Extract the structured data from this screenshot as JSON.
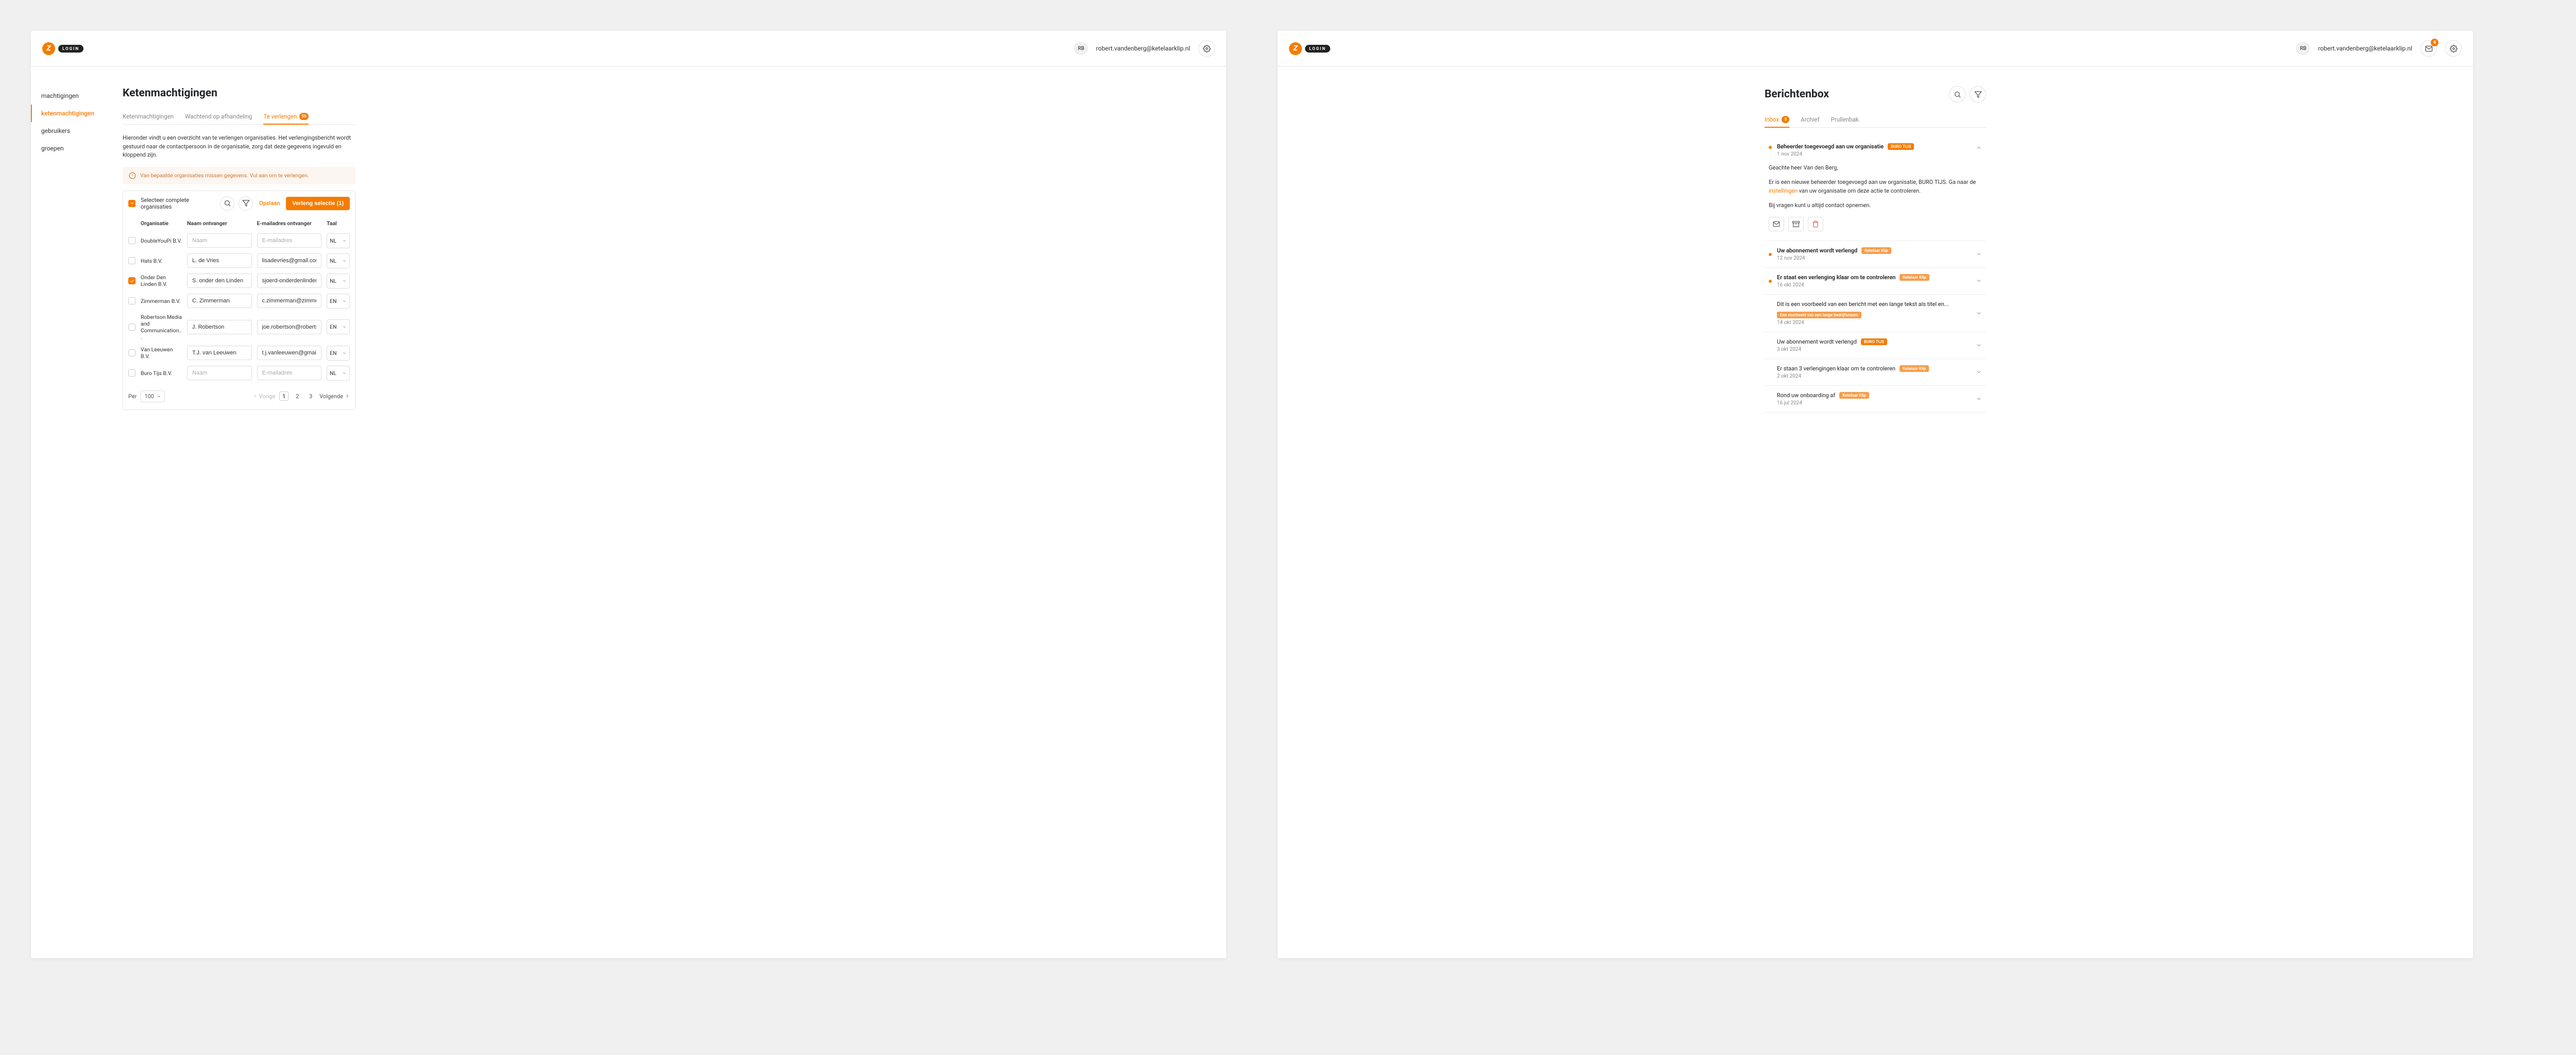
{
  "brand": {
    "letter": "Z",
    "pill": "LOGIN"
  },
  "user": {
    "initials": "RB",
    "email": "robert.vandenberg@ketelaarklip.nl"
  },
  "inbox_badge": "4",
  "colors": {
    "primary": "#f57c00",
    "tag_buro": "#f57c00",
    "tag_ketelaar": "#f79d4a",
    "tag_long": "#f79d4a"
  },
  "left": {
    "title": "Ketenmachtigingen",
    "sidebar": [
      {
        "label": "machtigingen"
      },
      {
        "label": "ketenmachtigingen"
      },
      {
        "label": "gebruikers"
      },
      {
        "label": "groepen"
      }
    ],
    "tabs": [
      {
        "label": "Ketenmachtigingen"
      },
      {
        "label": "Wachtend op afhandeling"
      },
      {
        "label": "Te verlengen",
        "badge": "56"
      }
    ],
    "intro": "Hieronder vindt u een overzicht van te verlengen organisaties. Het verlengingsbericht wordt gestuurd naar de contactpersoon in de organisatie, zorg dat deze gegevens ingevuld en kloppend zijn.",
    "alert": "Van bepaalde organisaties missen gegevens. Vul aan om te verlengen.",
    "toolbar": {
      "select_label": "Selecteer complete organisaties",
      "save": "Opslaan",
      "extend": "Verleng selectie (1)"
    },
    "columns": {
      "org": "Organisatie",
      "name": "Naam ontvanger",
      "email": "E-mailadres ontvanger",
      "lang": "Taal"
    },
    "placeholders": {
      "name": "Naam",
      "email": "E-mailadres"
    },
    "rows": [
      {
        "checked": false,
        "org": "DoubleYouPi B.V.",
        "name": "",
        "email": "",
        "lang": "NL"
      },
      {
        "checked": false,
        "org": "Hats B.V.",
        "name": "L. de Vries",
        "email": "lisadevries@gmail.com",
        "lang": "NL"
      },
      {
        "checked": true,
        "org": "Onder Den Linden B.V.",
        "name": "S. onder den Linden",
        "email": "sjoerd-onderdenlinden@onderdenl",
        "lang": "NL"
      },
      {
        "checked": false,
        "org": "Zimmerman B.V.",
        "name": "C. Zimmerman",
        "email": "c.zimmerman@zimmerman.com",
        "lang": "EN"
      },
      {
        "checked": false,
        "org": "Robertson Media and Communication...",
        "name": "J. Robertson",
        "email": "joe.robertson@robertsoncommun",
        "lang": "EN"
      },
      {
        "checked": false,
        "org": "Van Leeuwen B.V.",
        "name": "T.J. van Leeuwen",
        "email": "t.j.vanleeuwen@gmail.com",
        "lang": "EN"
      },
      {
        "checked": false,
        "org": "Buro Tijs B.V.",
        "name": "",
        "email": "",
        "lang": "NL"
      }
    ],
    "pagination": {
      "per_label": "Per",
      "per_value": "100",
      "prev": "Vorige",
      "next": "Volgende",
      "pages": [
        "1",
        "2",
        "3"
      ]
    }
  },
  "right": {
    "title": "Berichtenbox",
    "tabs": [
      {
        "label": "Inbox",
        "badge": "3"
      },
      {
        "label": "Archief"
      },
      {
        "label": "Prullenbak"
      }
    ],
    "messages": [
      {
        "unread": true,
        "expanded": true,
        "title": "Beheerder toegevoegd aan uw organisatie",
        "tag": "BURO TIJS",
        "tag_color": "tag_buro",
        "date": "1 nov 2024",
        "body_greeting": "Geachte heer Van den Berg,",
        "body_line1a": "Er is een nieuwe beheerder toegevoegd aan uw organisatie, BURO TIJS. Ga naar de ",
        "body_link": "instellingen",
        "body_line1b": " van uw organisatie om deze actie te controleren.",
        "body_line2": "Bij vragen kunt u altijd contact opnemen."
      },
      {
        "unread": true,
        "title": "Uw abonnement wordt verlengd",
        "tag": "Ketelaar Klip",
        "tag_color": "tag_ketelaar",
        "date": "12 nov 2024"
      },
      {
        "unread": true,
        "title": "Er staat een verlenging klaar om te controleren",
        "tag": "Ketelaar Klip",
        "tag_color": "tag_ketelaar",
        "date": "16 okt 2024"
      },
      {
        "unread": false,
        "title": "Dit is een voorbeeld van een bericht met een lange tekst als titel en...",
        "tag": "Een voorbeeld van een lange bedrijfsnaam",
        "tag_color": "tag_long",
        "date": "14 okt 2024"
      },
      {
        "unread": false,
        "title": "Uw abonnement wordt verlengd",
        "tag": "BURO TIJS",
        "tag_color": "tag_buro",
        "date": "3 okt 2024"
      },
      {
        "unread": false,
        "title": "Er staan 3 verlengingen klaar om te controleren",
        "tag": "Ketelaar Klip",
        "tag_color": "tag_ketelaar",
        "date": "2 okt 2024"
      },
      {
        "unread": false,
        "title": "Rond uw onboarding af",
        "tag": "Ketelaar Klip",
        "tag_color": "tag_ketelaar",
        "date": "16 jul 2024"
      }
    ]
  }
}
